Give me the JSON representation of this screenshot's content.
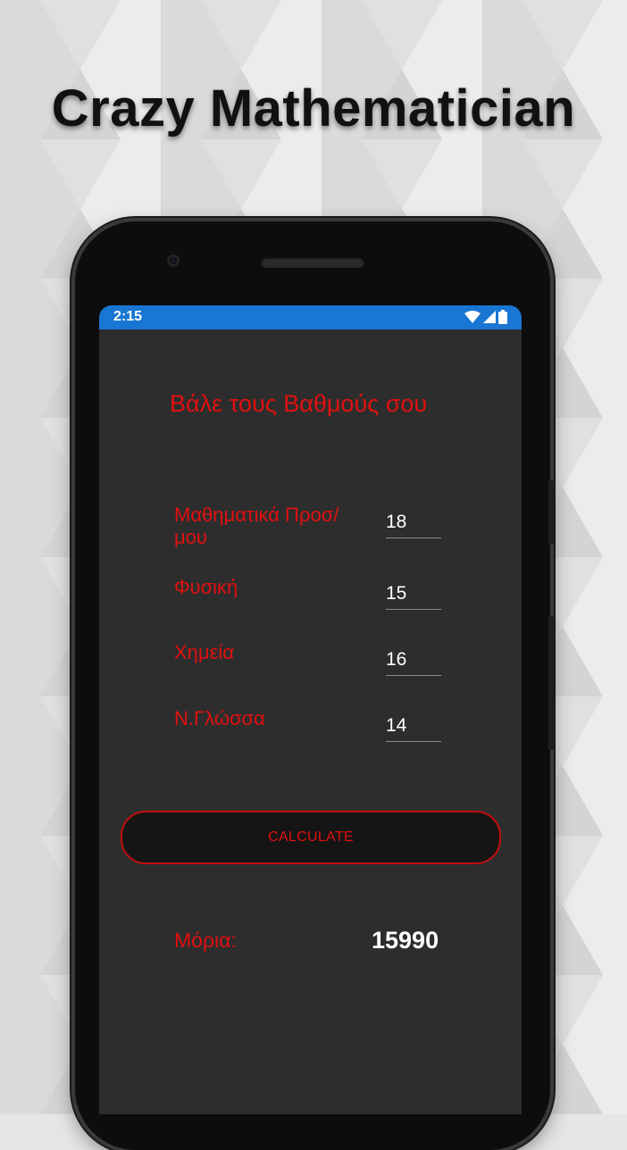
{
  "promo": {
    "title": "Crazy Mathematician"
  },
  "status_bar": {
    "time": "2:15",
    "icons": [
      "wifi-icon",
      "signal-icon",
      "battery-icon"
    ]
  },
  "app": {
    "heading": "Βάλε τους Βαθμούς σου",
    "subjects": [
      {
        "label": "Μαθηματικά Προσ/ μου",
        "value": "18"
      },
      {
        "label": "Φυσική",
        "value": "15"
      },
      {
        "label": "Χημεία",
        "value": "16"
      },
      {
        "label": "Ν.Γλώσσα",
        "value": "14"
      }
    ],
    "calculate_label": "CALCULATE",
    "result_label": "Μόρια:",
    "result_value": "15990"
  },
  "colors": {
    "accent_red": "#e01010",
    "status_bar_blue": "#1976d2",
    "screen_bg": "#2d2d2d"
  }
}
